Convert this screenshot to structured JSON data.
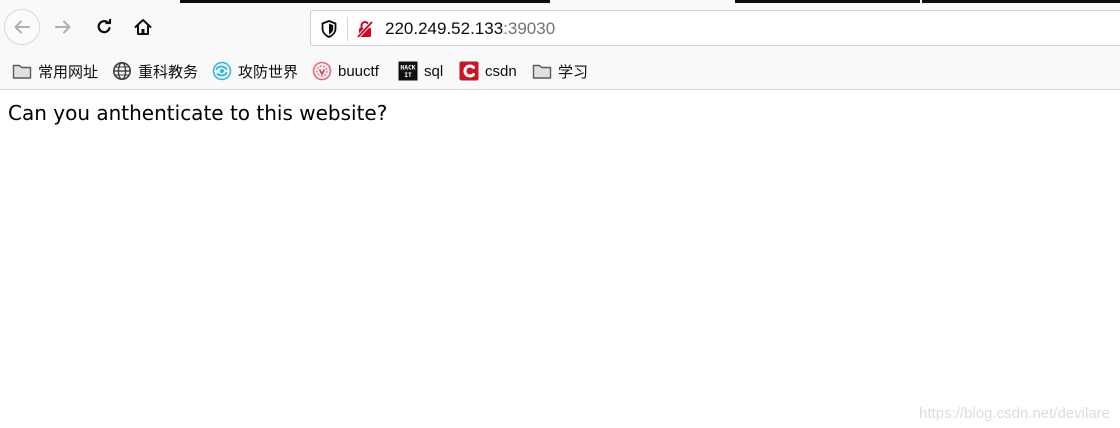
{
  "address_bar": {
    "host": "220.249.52.133",
    "port": ":39030"
  },
  "bookmarks": [
    {
      "label": "常用网址",
      "icon": "folder-icon"
    },
    {
      "label": "重科教务",
      "icon": "globe-icon"
    },
    {
      "label": "攻防世界",
      "icon": "adworld-icon"
    },
    {
      "label": "buuctf",
      "icon": "buuctf-icon"
    },
    {
      "label": "sql",
      "icon": "hackit-icon",
      "icon_text": "HACK IT"
    },
    {
      "label": "csdn",
      "icon": "csdn-icon",
      "icon_text": "C"
    },
    {
      "label": "学习",
      "icon": "folder-icon"
    }
  ],
  "page": {
    "message": "Can you anthenticate to this website?"
  },
  "watermark": "https://blog.csdn.net/devilare",
  "colors": {
    "chrome_bg": "#f9f9fa",
    "csdn_red": "#c81623",
    "lock_red": "#d70022"
  }
}
